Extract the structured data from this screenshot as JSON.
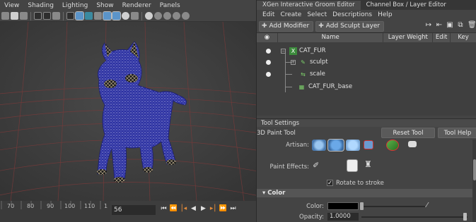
{
  "viewport": {
    "menu": [
      "View",
      "Shading",
      "Lighting",
      "Show",
      "Renderer",
      "Panels"
    ],
    "toolbar_icons": [
      "camera-icon",
      "bookmark-icon",
      "image-plane-icon",
      "film-gate-icon",
      "resolution-gate-icon",
      "grid-icon",
      "wireframe-icon",
      "smooth-shade-icon",
      "textured-icon",
      "lights-icon",
      "shadows-icon",
      "xray-icon",
      "isolate-icon",
      "exposure-icon",
      "gamma-icon"
    ],
    "timeline": {
      "ticks": [
        "70",
        "80",
        "90",
        "100",
        "110",
        "1"
      ],
      "current_frame": "56",
      "controls": [
        "go-to-start-icon",
        "step-back-key-icon",
        "step-back-frame-icon",
        "play-back-icon",
        "play-forward-icon",
        "step-forward-frame-icon",
        "step-forward-key-icon",
        "go-to-end-icon"
      ]
    }
  },
  "xgen": {
    "tabs": [
      "XGen Interactive Groom Editor",
      "Channel Box / Layer Editor"
    ],
    "menu": [
      "Edit",
      "Create",
      "Select",
      "Descriptions",
      "Help"
    ],
    "add_modifier": "Add Modifier",
    "add_sculpt_layer": "Add Sculpt Layer",
    "columns": {
      "visibility": "◉",
      "name": "Name",
      "layer_weight": "Layer Weight",
      "edit": "Edit",
      "key": "Key"
    },
    "tree": [
      {
        "label": "CAT_FUR",
        "icon": "xgen-description-icon"
      },
      {
        "label": "sculpt",
        "icon": "sculpt-icon"
      },
      {
        "label": "scale",
        "icon": "scale-modifier-icon"
      },
      {
        "label": "CAT_FUR_base",
        "icon": "base-grid-icon"
      }
    ]
  },
  "tool_settings": {
    "header": "Tool Settings",
    "tool_name": "3D Paint Tool",
    "reset_tool": "Reset Tool",
    "tool_help": "Tool Help",
    "artisan_label": "Artisan:",
    "paint_effects_label": "Paint Effects:",
    "rotate_to_stroke": "Rotate to stroke",
    "rotate_to_stroke_checked": true,
    "color_section": "Color",
    "color_label": "Color:",
    "opacity_label": "Opacity:",
    "opacity_value": "1.0000",
    "color_value": "#000000"
  }
}
